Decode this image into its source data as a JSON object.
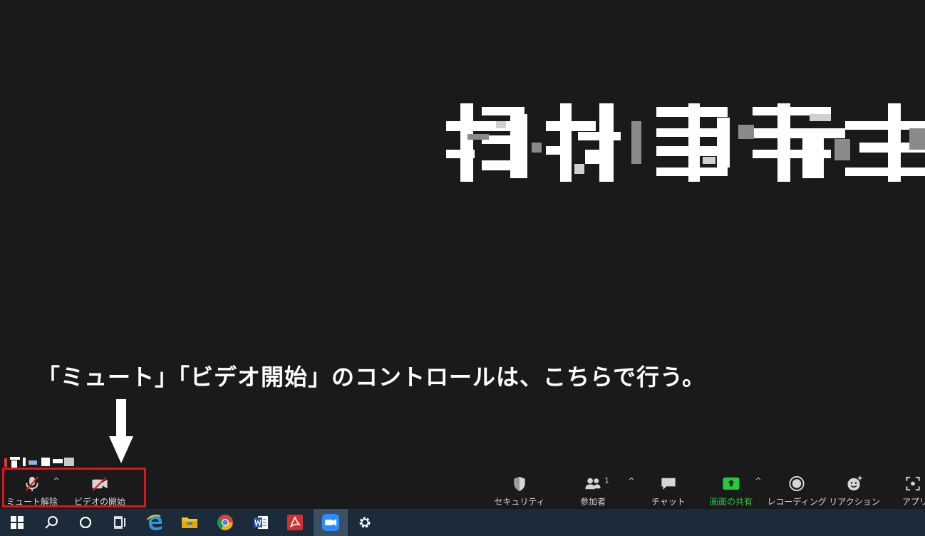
{
  "instruction_text": "「ミュート」「ビデオ開始」のコントロールは、こちらで行う。",
  "toolbar": {
    "mute": {
      "label": "ミュート解除",
      "icon": "microphone-muted-icon"
    },
    "video": {
      "label": "ビデオの開始",
      "icon": "video-off-icon"
    },
    "security": {
      "label": "セキュリティ",
      "icon": "shield-icon"
    },
    "participants": {
      "label": "参加者",
      "icon": "participants-icon",
      "count": "1"
    },
    "chat": {
      "label": "チャット",
      "icon": "chat-icon"
    },
    "share": {
      "label": "画面の共有",
      "icon": "share-screen-icon"
    },
    "record": {
      "label": "レコーディング",
      "icon": "record-icon"
    },
    "reactions": {
      "label": "リアクション",
      "icon": "reaction-icon"
    },
    "apps": {
      "label": "アプリ",
      "icon": "apps-icon"
    },
    "caret": "^"
  },
  "taskbar": {
    "items": [
      "windows-start-icon",
      "search-icon",
      "cortana-icon",
      "task-view-icon",
      "edge-icon",
      "file-explorer-icon",
      "chrome-icon",
      "word-icon",
      "acrobat-icon",
      "zoom-icon",
      "settings-icon"
    ]
  },
  "colors": {
    "background": "#1a1a1a",
    "highlight": "#e0151b",
    "share_green": "#27c93f",
    "taskbar": "#1c2b3a"
  }
}
